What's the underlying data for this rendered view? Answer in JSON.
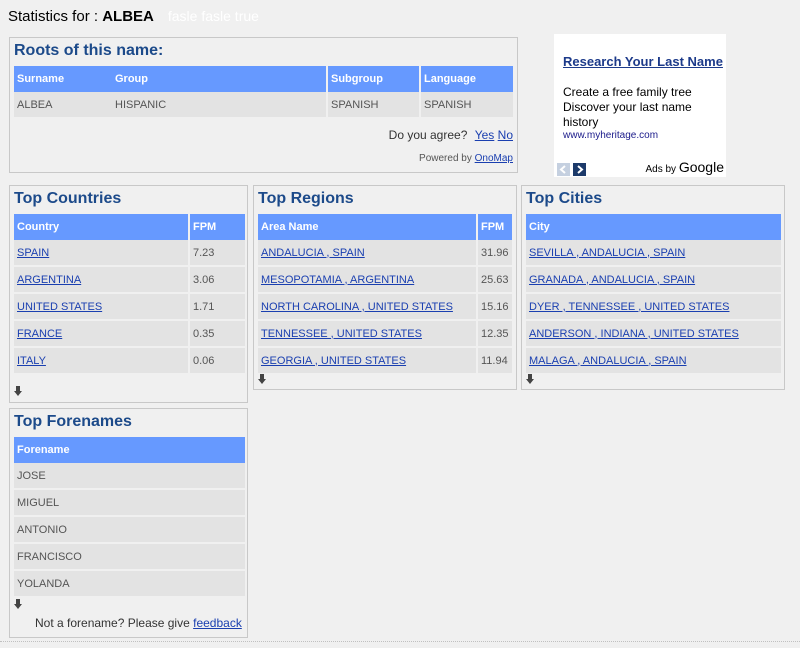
{
  "header": {
    "prefix": "Statistics for : ",
    "surname": "ALBEA",
    "ghost_text": "fasle fasle  true"
  },
  "roots": {
    "title": "Roots of this name:",
    "columns": [
      "Surname",
      "Group",
      "Subgroup",
      "Language"
    ],
    "row": [
      "ALBEA",
      "HISPANIC",
      "SPANISH",
      "SPANISH"
    ],
    "agree_prompt": "Do you agree?",
    "yes": "Yes",
    "no": "No",
    "powered_by": "Powered by",
    "powered_link": "OnoMap"
  },
  "ad": {
    "title": "Research Your Last Name",
    "text": "Create a free family tree Discover your last name history",
    "url": "www.myheritage.com",
    "ads_by": "Ads by",
    "google": "Google",
    "prev_icon": "chevron-left-icon",
    "next_icon": "chevron-right-icon"
  },
  "countries": {
    "title": "Top Countries",
    "col_name": "Country",
    "col_value": "FPM",
    "rows": [
      {
        "name": "SPAIN",
        "value": "7.23"
      },
      {
        "name": "ARGENTINA",
        "value": "3.06"
      },
      {
        "name": "UNITED STATES",
        "value": "1.71"
      },
      {
        "name": "FRANCE",
        "value": "0.35"
      },
      {
        "name": "ITALY",
        "value": "0.06"
      }
    ]
  },
  "regions": {
    "title": "Top Regions",
    "col_name": "Area Name",
    "col_value": "FPM",
    "rows": [
      {
        "name": "ANDALUCIA , SPAIN",
        "value": "31.96"
      },
      {
        "name": "MESOPOTAMIA , ARGENTINA",
        "value": "25.63"
      },
      {
        "name": "NORTH CAROLINA , UNITED STATES",
        "value": "15.16"
      },
      {
        "name": "TENNESSEE , UNITED STATES",
        "value": "12.35"
      },
      {
        "name": "GEORGIA , UNITED STATES",
        "value": "11.94"
      }
    ]
  },
  "cities": {
    "title": "Top Cities",
    "col_name": "City",
    "rows": [
      "SEVILLA , ANDALUCIA , SPAIN",
      "GRANADA , ANDALUCIA , SPAIN",
      "DYER , TENNESSEE , UNITED STATES",
      "ANDERSON , INDIANA , UNITED STATES",
      "MALAGA , ANDALUCIA , SPAIN"
    ]
  },
  "forenames": {
    "title": "Top Forenames",
    "col_name": "Forename",
    "rows": [
      "JOSE",
      "MIGUEL",
      "ANTONIO",
      "FRANCISCO",
      "YOLANDA"
    ],
    "feedback_prompt": "Not a forename? Please give",
    "feedback_link": "feedback"
  },
  "colors": {
    "header_blue": "#6699ff",
    "title_blue": "#1c4a8a",
    "row_gray": "#e3e3e3",
    "link_blue": "#1a3fb0"
  }
}
